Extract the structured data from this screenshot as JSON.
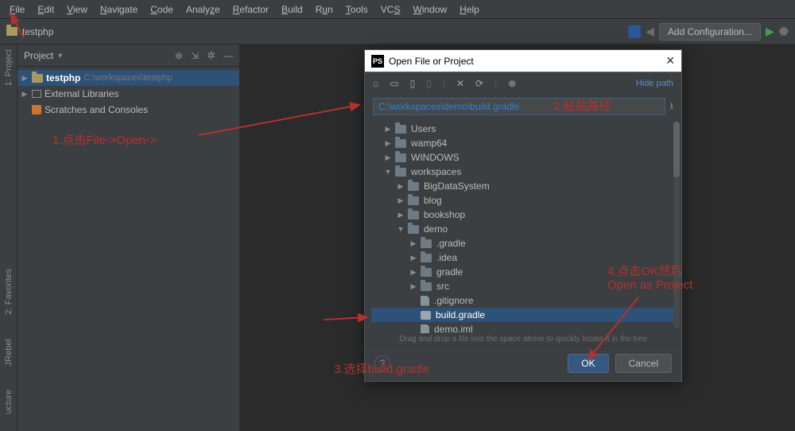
{
  "menu": [
    "File",
    "Edit",
    "View",
    "Navigate",
    "Code",
    "Analyze",
    "Refactor",
    "Build",
    "Run",
    "Tools",
    "VCS",
    "Window",
    "Help"
  ],
  "toolbar": {
    "project_breadcrumb": "testphp",
    "add_config": "Add Configuration..."
  },
  "panel": {
    "title": "Project",
    "root_name": "testphp",
    "root_path": "C:\\workspaces\\testphp",
    "external": "External Libraries",
    "scratches": "Scratches and Consoles"
  },
  "dialog": {
    "title": "Open File or Project",
    "hide_path": "Hide path",
    "path_value": "C:\\workspaces\\demo\\build.gradle",
    "tree": [
      {
        "level": 1,
        "arrow": "▶",
        "type": "folder",
        "name": "Users"
      },
      {
        "level": 1,
        "arrow": "▶",
        "type": "folder",
        "name": "wamp64"
      },
      {
        "level": 1,
        "arrow": "▶",
        "type": "folder",
        "name": "WINDOWS"
      },
      {
        "level": 1,
        "arrow": "▼",
        "type": "folder",
        "name": "workspaces"
      },
      {
        "level": 2,
        "arrow": "▶",
        "type": "folder",
        "name": "BigDataSystem"
      },
      {
        "level": 2,
        "arrow": "▶",
        "type": "folder",
        "name": "blog"
      },
      {
        "level": 2,
        "arrow": "▶",
        "type": "folder",
        "name": "bookshop"
      },
      {
        "level": 2,
        "arrow": "▼",
        "type": "folder",
        "name": "demo"
      },
      {
        "level": 3,
        "arrow": "▶",
        "type": "folder",
        "name": ".gradle"
      },
      {
        "level": 3,
        "arrow": "▶",
        "type": "folder",
        "name": ".idea"
      },
      {
        "level": 3,
        "arrow": "▶",
        "type": "folder",
        "name": "gradle"
      },
      {
        "level": 3,
        "arrow": "▶",
        "type": "folder",
        "name": "src"
      },
      {
        "level": 3,
        "arrow": "",
        "type": "file",
        "name": ".gitignore"
      },
      {
        "level": 3,
        "arrow": "",
        "type": "gradle",
        "name": "build.gradle",
        "selected": true
      },
      {
        "level": 3,
        "arrow": "",
        "type": "file",
        "name": "demo.iml"
      }
    ],
    "hint": "Drag and drop a file into the space above to quickly locate it in the tree",
    "ok": "OK",
    "cancel": "Cancel"
  },
  "annot": {
    "a1": "1.点击File->Open->",
    "a2": "2.粘贴路径",
    "a3": "3.选择build.gradle",
    "a4_line1": "4.点击OK然后",
    "a4_line2": "Open as Project"
  },
  "rail": {
    "project": "1: Project",
    "favorites": "2: Favorites",
    "jrebel": "JRebel",
    "structure": "ucture"
  }
}
